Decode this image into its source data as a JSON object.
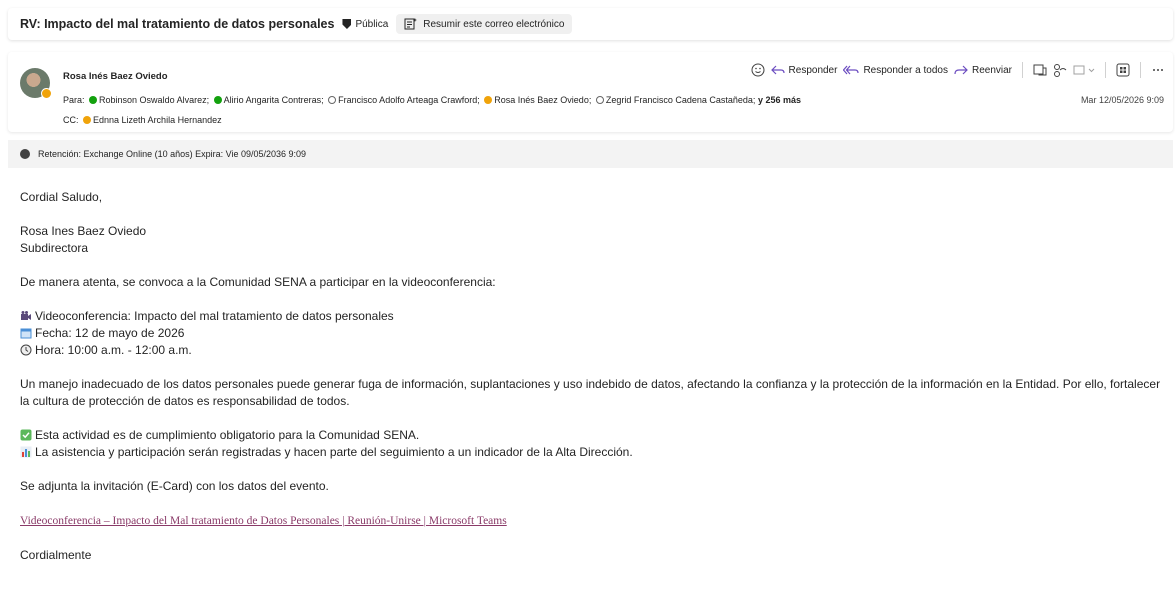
{
  "subject_bar": {
    "subject": "RV: Impacto del mal tratamiento de datos personales",
    "sensitivity": "Pública",
    "summarize_label": "Resumir este correo electrónico"
  },
  "header": {
    "sender": "Rosa Inés Baez Oviedo",
    "to_label": "Para:",
    "recipients": [
      {
        "name": "Robinson Oswaldo Alvarez;",
        "status": "available"
      },
      {
        "name": "Alirio Angarita Contreras;",
        "status": "available"
      },
      {
        "name": "Francisco Adolfo Arteaga Crawford;",
        "status": "offline"
      },
      {
        "name": "Rosa Inés Baez Oviedo;",
        "status": "away"
      },
      {
        "name": "Zegrid Francisco Cadena Castañeda;",
        "status": "offline"
      }
    ],
    "more_recipients": "y 256 más",
    "cc_label": "CC:",
    "cc_name": "Ednna Lizeth Archila Hernandez",
    "date": "Mar 12/05/2026 9:09",
    "actions": {
      "reply": "Responder",
      "reply_all": "Responder a todos",
      "forward": "Reenviar"
    }
  },
  "retention": "Retención: Exchange Online (10 años) Expira: Vie 09/05/2036 9:09",
  "body": {
    "greeting": "Cordial Saludo,",
    "sig_name": "Rosa Ines Baez Oviedo",
    "sig_title": "Subdirectora",
    "intro": "De manera atenta, se convoca a la Comunidad SENA a participar en la videoconferencia:",
    "event": "Videoconferencia: Impacto del mal tratamiento de datos personales",
    "date_line": "Fecha: 12 de mayo de 2026",
    "time_line": "Hora: 10:00 a.m. - 12:00 a.m.",
    "paragraph": "Un manejo inadecuado de los datos personales puede generar fuga de información, suplantaciones y uso indebido de datos, afectando la confianza y la protección de la información en la Entidad. Por ello, fortalecer la cultura de protección de datos es responsabilidad de todos.",
    "mandatory": "Esta actividad es de cumplimiento obligatorio para la Comunidad SENA.",
    "attendance": "La asistencia y participación serán registradas y hacen parte del seguimiento a un indicador de la Alta Dirección.",
    "attach": "Se adjunta la invitación (E-Card) con los datos del evento.",
    "link": "Videoconferencia – Impacto del Mal tratamiento de Datos Personales | Reunión-Unirse | Microsoft Teams",
    "closing": "Cordialmente"
  }
}
